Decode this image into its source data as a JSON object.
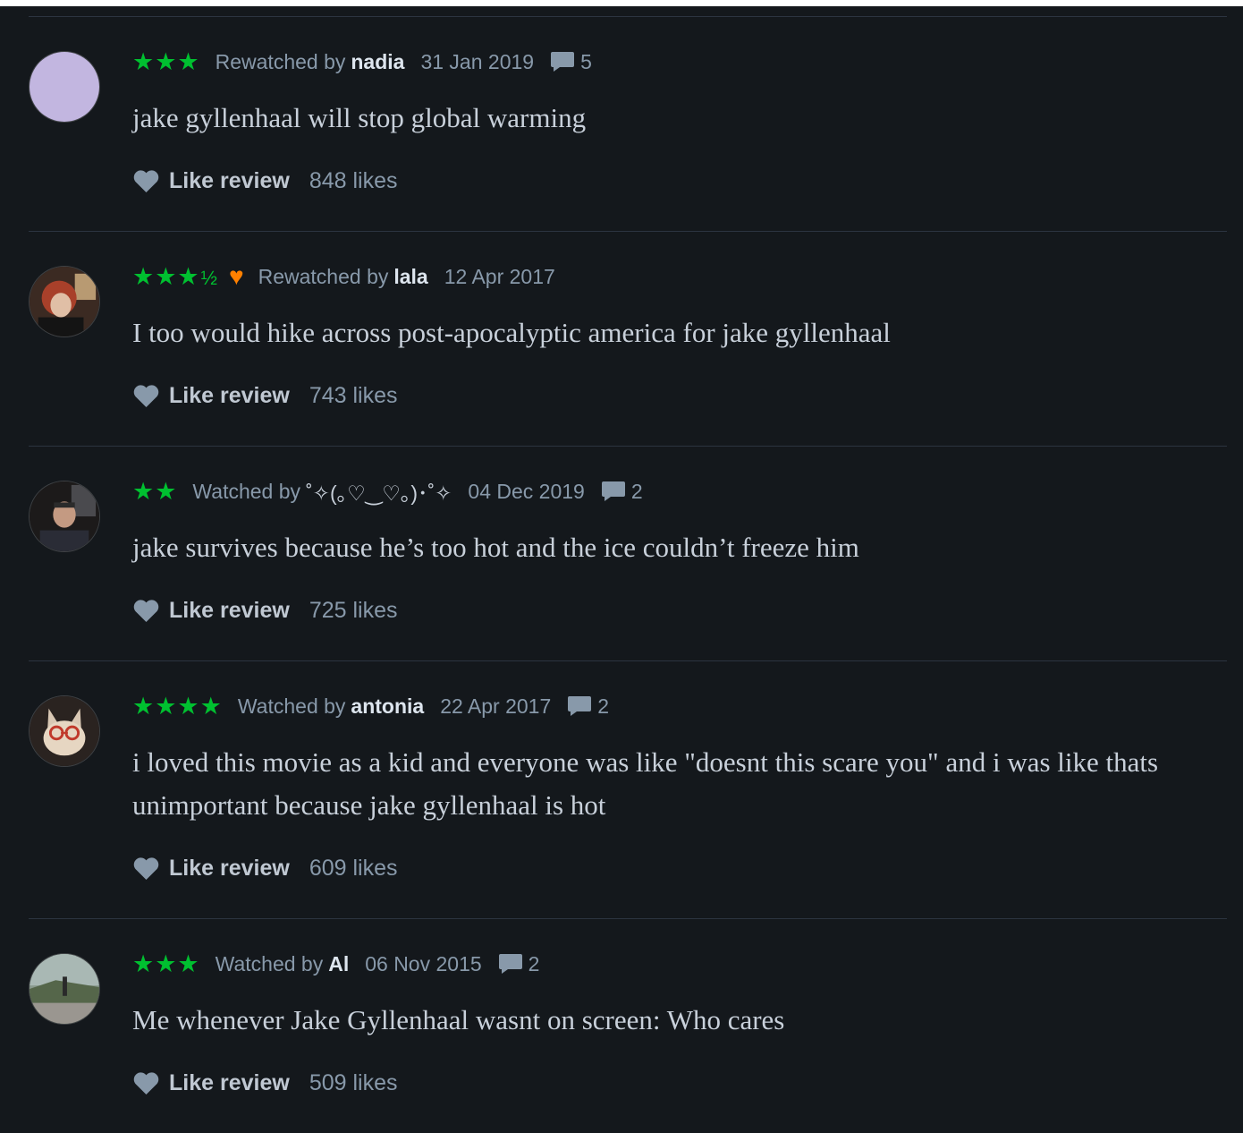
{
  "accent_colors": {
    "stars": "#00c030",
    "liked_heart": "#ff8000",
    "background": "#14181c"
  },
  "like_label": "Like review",
  "reviews": [
    {
      "avatar": "avatar-placeholder",
      "stars": "★★★",
      "half": "",
      "activity": "Rewatched by",
      "user": "nadia",
      "date": "31 Jan 2019",
      "comments": "5",
      "text": "jake gyllenhaal will stop global warming",
      "likes": "848 likes"
    },
    {
      "avatar": "avatar-photo",
      "stars": "★★★",
      "half": "½",
      "liked": true,
      "activity": "Rewatched by",
      "user": "lala",
      "date": "12 Apr 2017",
      "comments": "",
      "text": "I too would hike across post-apocalyptic america for jake gyllenhaal",
      "likes": "743 likes"
    },
    {
      "avatar": "avatar-photo",
      "stars": "★★",
      "half": "",
      "activity": "Watched by",
      "user": "˚✧(｡♡‿♡｡)･˚✧",
      "date": "04 Dec 2019",
      "comments": "2",
      "text": "jake survives because he’s too hot and the ice couldn’t freeze him",
      "likes": "725 likes"
    },
    {
      "avatar": "avatar-photo",
      "stars": "★★★★",
      "half": "",
      "activity": "Watched by",
      "user": "antonia",
      "date": "22 Apr 2017",
      "comments": "2",
      "text": "i loved this movie as a kid and everyone was like \"doesnt this scare you\" and i was like thats unimportant because jake gyllenhaal is hot",
      "likes": "609 likes"
    },
    {
      "avatar": "avatar-photo",
      "stars": "★★★",
      "half": "",
      "activity": "Watched by",
      "user": "Al",
      "date": "06 Nov 2015",
      "comments": "2",
      "text": "Me whenever Jake Gyllenhaal wasnt on screen: Who cares",
      "likes": "509 likes"
    }
  ]
}
